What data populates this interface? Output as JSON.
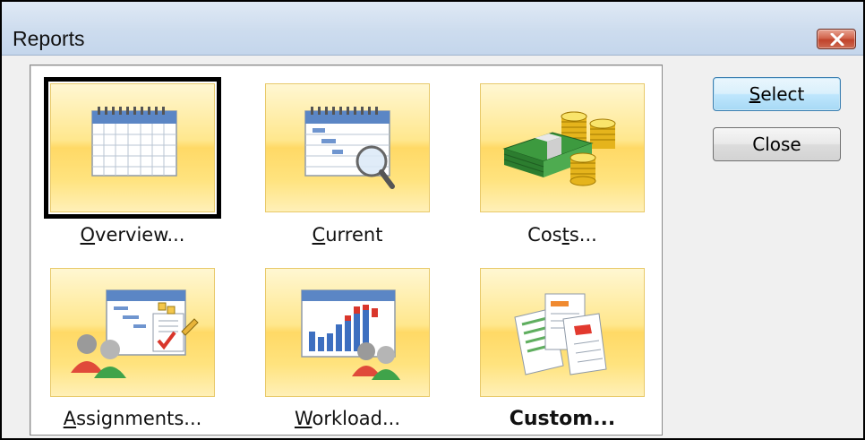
{
  "window": {
    "title": "Reports"
  },
  "reports": [
    {
      "label_u": "O",
      "label_rest": "verview...",
      "icon": "calendar-icon",
      "selected": true
    },
    {
      "label_u": "C",
      "label_rest": "urrent",
      "icon": "calendar-magnifier-icon",
      "selected": false
    },
    {
      "label_pre": "Cos",
      "label_u": "t",
      "label_rest": "s...",
      "icon": "money-coins-icon",
      "selected": false
    },
    {
      "label_u": "A",
      "label_rest": "ssignments...",
      "icon": "people-tasks-icon",
      "selected": false
    },
    {
      "label_u": "W",
      "label_rest": "orkload...",
      "icon": "bar-chart-people-icon",
      "selected": false
    },
    {
      "label_full": "Custom...",
      "icon": "documents-icon",
      "selected": false
    }
  ],
  "buttons": {
    "select_u": "S",
    "select_rest": "elect",
    "close": "Close"
  },
  "colors": {
    "tile_yellow": "#ffd966",
    "title_bar": "#cddcee",
    "close_red": "#c0432b",
    "default_button_blue": "#bee6fd"
  }
}
